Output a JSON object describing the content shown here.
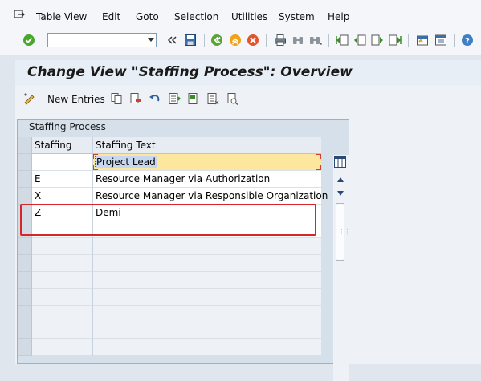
{
  "menu": {
    "items": [
      "Table View",
      "Edit",
      "Goto",
      "Selection",
      "Utilities",
      "System",
      "Help"
    ]
  },
  "toolbar": {
    "command_value": "",
    "icons": [
      "enter-icon",
      "back-double-chevron-icon",
      "save-icon",
      "back-icon",
      "exit-icon",
      "cancel-icon",
      "print-icon",
      "find-icon",
      "find-next-icon",
      "first-page-icon",
      "previous-page-icon",
      "next-page-icon",
      "last-page-icon",
      "create-session-icon",
      "shortcut-icon",
      "help-icon"
    ]
  },
  "title": {
    "text": "Change View \"Staffing Process\": Overview"
  },
  "app_toolbar": {
    "new_entries_label": "New Entries"
  },
  "table": {
    "panel_title": "Staffing Process",
    "columns": [
      "Staffing",
      "Staffing Text"
    ],
    "rows": [
      {
        "staffing": "",
        "text": "Project Lead"
      },
      {
        "staffing": "E",
        "text": "Resource Manager via Authorization"
      },
      {
        "staffing": "X",
        "text": "Resource Manager via Responsible Organization"
      },
      {
        "staffing": "Z",
        "text": "Demi"
      }
    ]
  },
  "colors": {
    "highlight": "#d7262b",
    "active_cell": "#fde79e"
  }
}
